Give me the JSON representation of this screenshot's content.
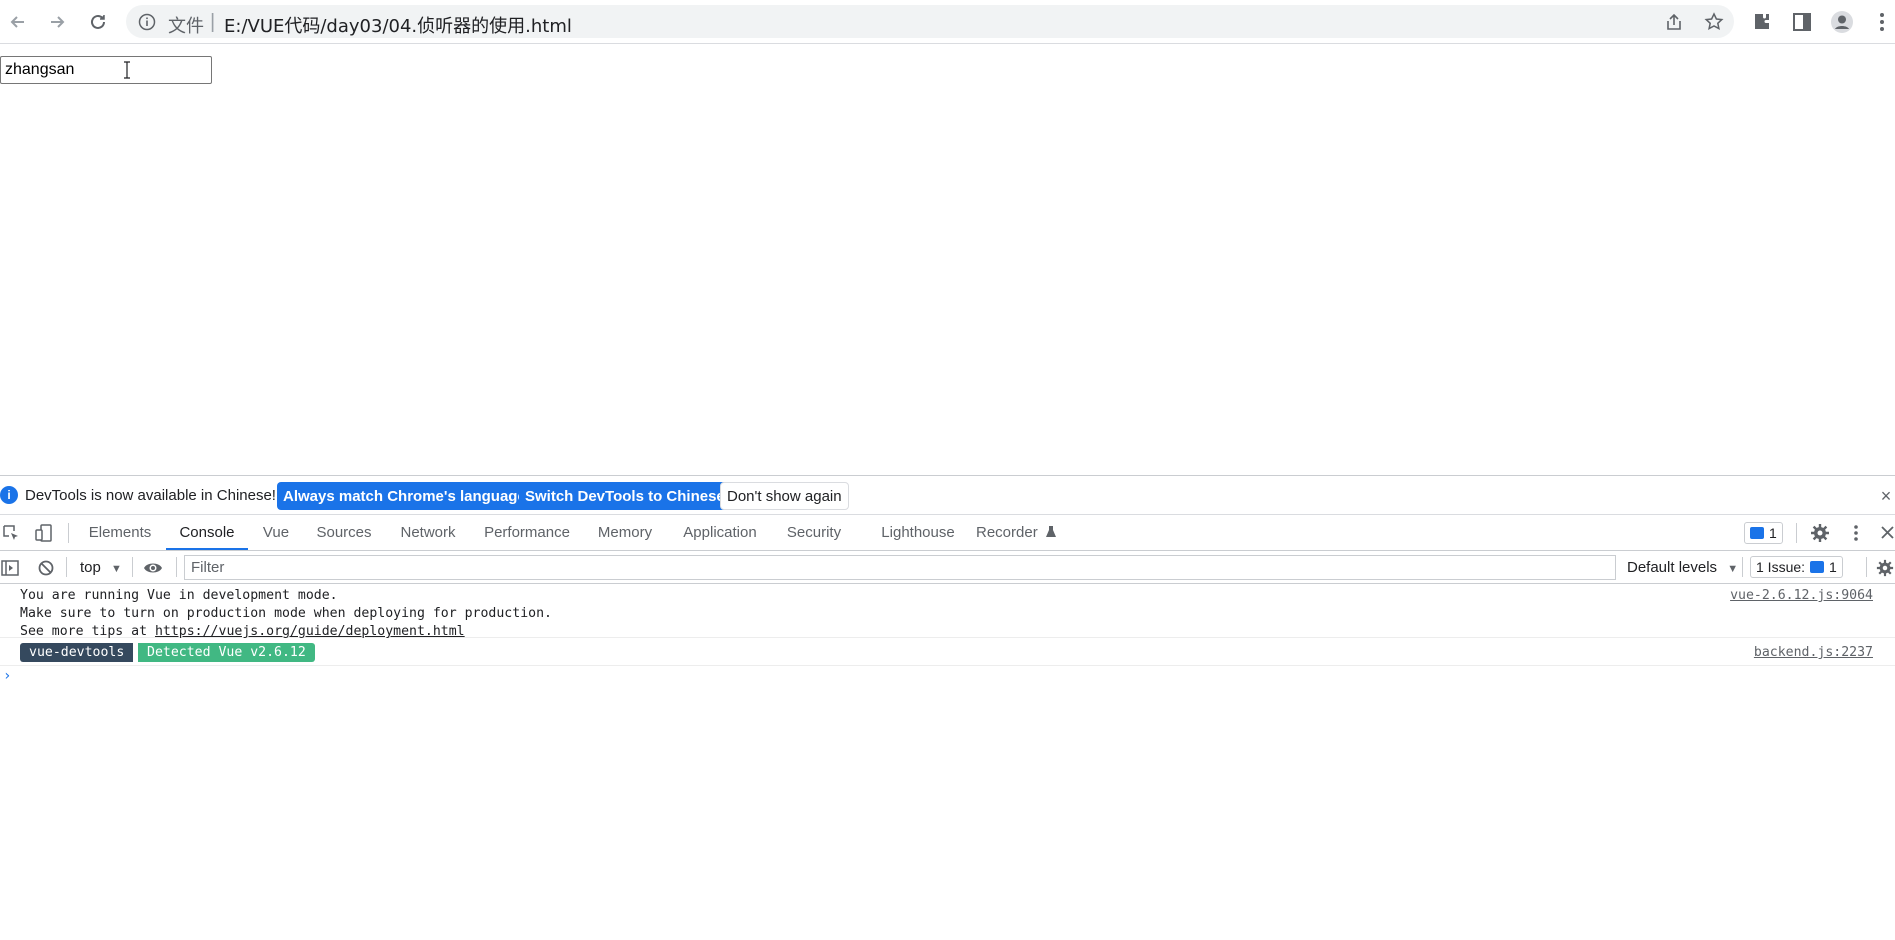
{
  "browser": {
    "url_prefix": "文件",
    "url_separator": "|",
    "url_path": "E:/VUE代码/day03/04.侦听器的使用.html"
  },
  "page": {
    "input_value": "zhangsan"
  },
  "devtools": {
    "infobar": {
      "message": "DevTools is now available in Chinese!",
      "btn_match": "Always match Chrome's language",
      "btn_switch": "Switch DevTools to Chinese",
      "btn_dismiss": "Don't show again",
      "close": "×"
    },
    "tabs": [
      {
        "label": "Elements"
      },
      {
        "label": "Console"
      },
      {
        "label": "Vue"
      },
      {
        "label": "Sources"
      },
      {
        "label": "Network"
      },
      {
        "label": "Performance"
      },
      {
        "label": "Memory"
      },
      {
        "label": "Application"
      },
      {
        "label": "Security"
      },
      {
        "label": "Lighthouse"
      },
      {
        "label": "Recorder"
      }
    ],
    "issues_count": "1",
    "filterbar": {
      "context": "top",
      "filter_placeholder": "Filter",
      "levels": "Default levels",
      "issues_label": "1 Issue:",
      "issues_count": "1"
    },
    "console": {
      "log1": {
        "line1": "You are running Vue in development mode.",
        "line2": "Make sure to turn on production mode when deploying for production.",
        "line3_prefix": "See more tips at ",
        "line3_link": "https://vuejs.org/guide/deployment.html",
        "source": "vue-2.6.12.js:9064"
      },
      "log2": {
        "badge1": "vue-devtools",
        "badge2": "Detected Vue v2.6.12",
        "source": "backend.js:2237"
      },
      "prompt": "›"
    }
  },
  "colors": {
    "accent": "#1a73e8",
    "vue_dark": "#35495e",
    "vue_green": "#41b883"
  }
}
